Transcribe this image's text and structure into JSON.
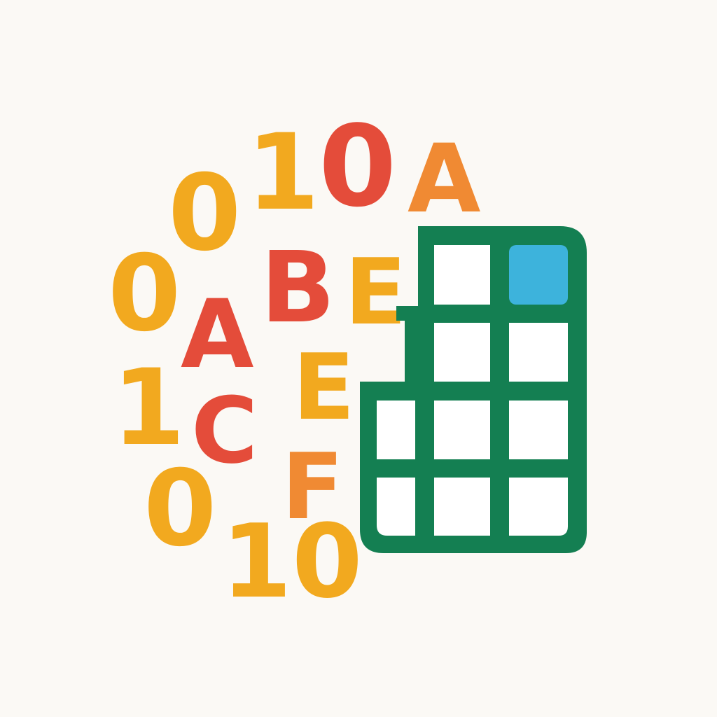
{
  "colors": {
    "background": "#fbf9f5",
    "yellow": "#f2a91f",
    "red": "#e44c3a",
    "orange": "#f08a33",
    "green": "#147f52",
    "blue": "#3db3dc",
    "cell": "#ffffff"
  },
  "glyphs": [
    {
      "text": "1",
      "color": "yellow"
    },
    {
      "text": "0",
      "color": "red"
    },
    {
      "text": "A",
      "color": "orange"
    },
    {
      "text": "0",
      "color": "yellow"
    },
    {
      "text": "0",
      "color": "yellow"
    },
    {
      "text": "B",
      "color": "red"
    },
    {
      "text": "E",
      "color": "yellow"
    },
    {
      "text": "A",
      "color": "red"
    },
    {
      "text": "1",
      "color": "yellow"
    },
    {
      "text": "E",
      "color": "yellow"
    },
    {
      "text": "C",
      "color": "red"
    },
    {
      "text": "0",
      "color": "yellow"
    },
    {
      "text": "F",
      "color": "orange"
    },
    {
      "text": "10",
      "color": "yellow"
    }
  ],
  "spreadsheet": {
    "icon": "spreadsheet-grid-icon",
    "highlighted_cell": "top-right"
  }
}
